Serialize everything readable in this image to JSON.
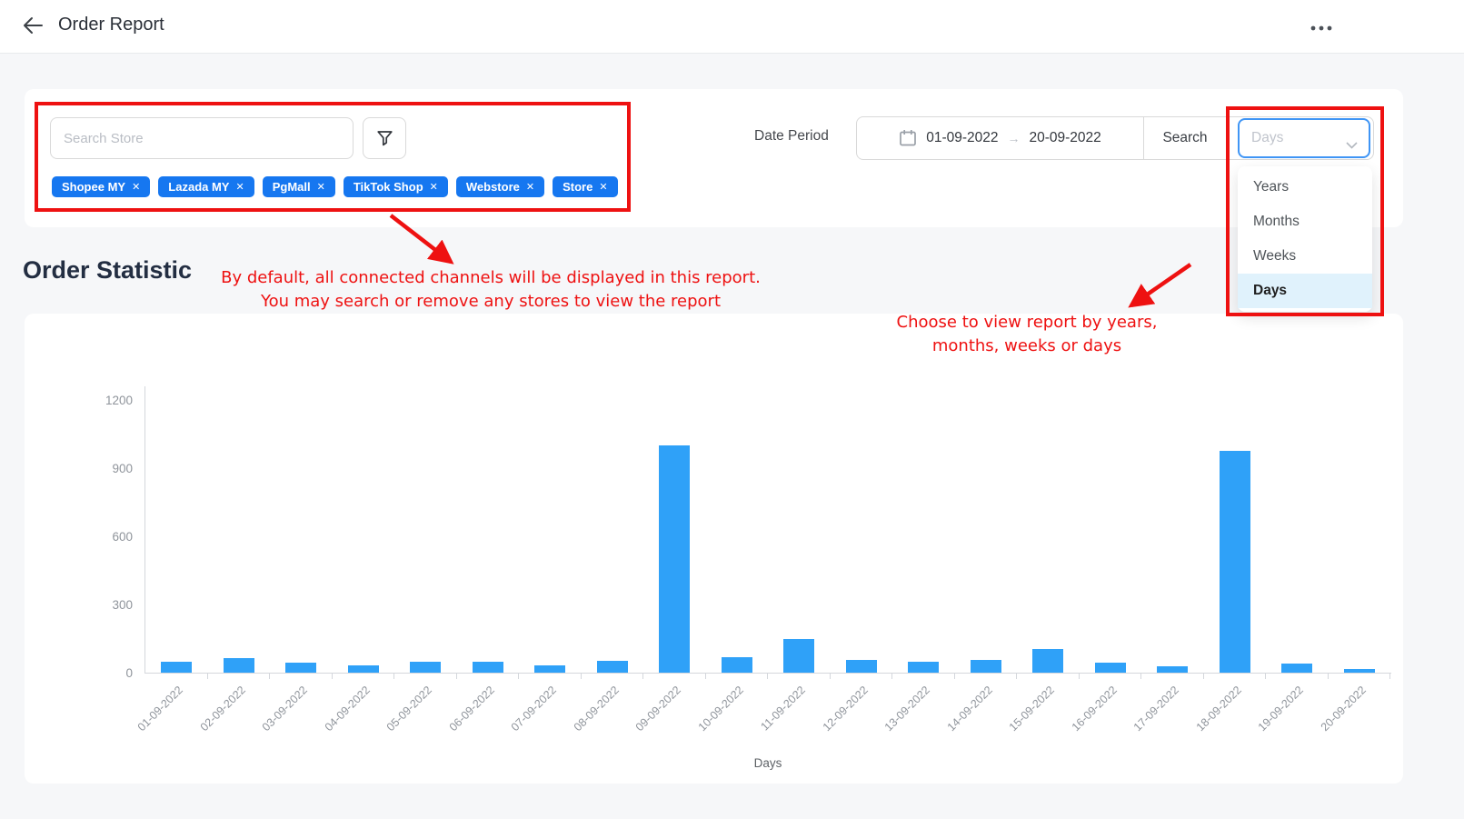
{
  "header": {
    "title": "Order Report"
  },
  "icons": {
    "back": "back-arrow",
    "menu": "ellipsis",
    "close": "✕",
    "range_arrow": "→",
    "filter": "funnel",
    "calendar": "calendar"
  },
  "filters": {
    "search_placeholder": "Search Store",
    "store_tags": [
      "Shopee MY",
      "Lazada MY",
      "PgMall",
      "TikTok Shop",
      "Webstore",
      "Store"
    ],
    "date_period_label": "Date Period",
    "date_from": "01-09-2022",
    "date_to": "20-09-2022",
    "search_label": "Search",
    "period_select": {
      "value": "Days",
      "options": [
        "Years",
        "Months",
        "Weeks",
        "Days"
      ],
      "selected_option": "Days"
    }
  },
  "annotations": {
    "stores_note_line1": "By default, all connected channels will be displayed in this report.",
    "stores_note_line2": "You may search or remove any stores to view the report",
    "period_note_line1": "Choose to view report by years,",
    "period_note_line2": "months, weeks or days"
  },
  "section": {
    "title": "Order Statistic"
  },
  "chart_data": {
    "type": "bar",
    "title": "Order Statistic",
    "categories": [
      "01-09-2022",
      "02-09-2022",
      "03-09-2022",
      "04-09-2022",
      "05-09-2022",
      "06-09-2022",
      "07-09-2022",
      "08-09-2022",
      "09-09-2022",
      "10-09-2022",
      "11-09-2022",
      "12-09-2022",
      "13-09-2022",
      "14-09-2022",
      "15-09-2022",
      "16-09-2022",
      "17-09-2022",
      "18-09-2022",
      "19-09-2022",
      "20-09-2022"
    ],
    "values": [
      47,
      65,
      44,
      33,
      50,
      48,
      31,
      54,
      1000,
      68,
      150,
      55,
      48,
      55,
      105,
      45,
      30,
      975,
      40,
      15
    ],
    "xlabel": "Days",
    "ylabel": "",
    "ylim": [
      0,
      1200
    ],
    "yticks": [
      0,
      300,
      600,
      900,
      1200
    ],
    "bar_color": "#2fa1f8",
    "grid": false,
    "legend": "none"
  },
  "colors": {
    "annotation_red": "#ee1111",
    "tag_blue": "#1677f0",
    "bar_blue": "#2fa1f8",
    "select_focus_blue": "#3f95f5",
    "option_selected_bg": "#e0f2fc"
  }
}
